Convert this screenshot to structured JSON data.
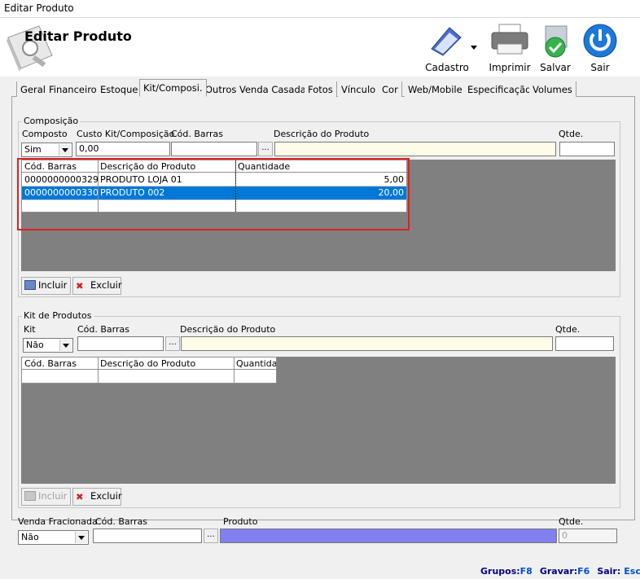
{
  "window": {
    "title": "Editar Produto"
  },
  "header": {
    "title": "Editar Produto"
  },
  "toolbar": {
    "cadastro": "Cadastro",
    "imprimir": "Imprimir",
    "salvar": "Salvar",
    "sair": "Sair"
  },
  "tabs": [
    "Geral",
    "Financeiro",
    "Estoque",
    "Kit/Composi.",
    "Outros",
    "Venda Casada",
    "Fotos",
    "Vínculo",
    "Cor",
    "Web/Mobile",
    "Especificação",
    "Volumes"
  ],
  "composicao": {
    "title": "Composição",
    "composto_label": "Composto",
    "composto_value": "Sim",
    "custo_label": "Custo Kit/Composição",
    "custo_value": "0,00",
    "cod_barras_label": "Cód. Barras",
    "cod_barras_value": "",
    "descricao_label": "Descrição do Produto",
    "descricao_value": "",
    "qtde_label": "Qtde.",
    "qtde_value": "",
    "dots": "...",
    "grid": {
      "headers": [
        "Cód. Barras",
        "Descrição do Produto",
        "Quantidade"
      ],
      "rows": [
        [
          "0000000000329",
          "PRODUTO LOJA 01",
          "5,00"
        ],
        [
          "0000000000330",
          "PRODUTO 002",
          "20,00"
        ]
      ]
    },
    "incluir": "Incluir",
    "excluir": "Excluir"
  },
  "kit": {
    "title": "Kit de Produtos",
    "kit_label": "Kit",
    "kit_value": "Não",
    "cod_barras_label": "Cód. Barras",
    "descricao_label": "Descrição do Produto",
    "qtde_label": "Qtde.",
    "dots": "...",
    "grid": {
      "headers": [
        "Cód. Barras",
        "Descrição do Produto",
        "Quantidade"
      ]
    },
    "incluir": "Incluir",
    "excluir": "Excluir"
  },
  "venda": {
    "fracionada_label": "Venda Fracionada",
    "fracionada_value": "Não",
    "cod_barras_label": "Cód. Barras",
    "produto_label": "Produto",
    "qtde_label": "Qtde.",
    "qtde_value": "0",
    "dots": "..."
  },
  "status": {
    "grupos_label": "Grupos:",
    "grupos_key": "F8",
    "gravar_label": "Gravar:",
    "gravar_key": "F6",
    "sair_label": "Sair:",
    "sair_key": "Esc"
  }
}
